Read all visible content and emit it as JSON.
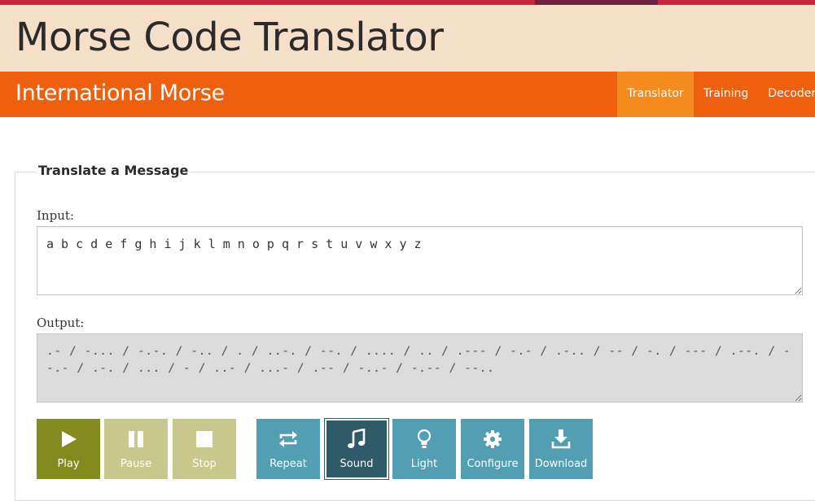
{
  "header": {
    "site_title": "Morse Code Translator",
    "subtitle": "International Morse"
  },
  "nav": {
    "items": [
      {
        "label": "Translator",
        "active": true
      },
      {
        "label": "Training",
        "active": false
      },
      {
        "label": "Decoder",
        "active": false
      }
    ]
  },
  "translate": {
    "legend": "Translate a Message",
    "input_label": "Input:",
    "input_value": "a b c d e f g h i j k l m n o p q r s t u v w x y z",
    "output_label": "Output:",
    "output_value": ".- / -... / -.-. / -.. / . / ..-. / --. / .... / .. / .--- / -.- / .-.. / -- / -. / --- / .--. / --.- / .-. / ... / - / ..- / ...- / .-- / -..- / -.-- / --.."
  },
  "controls": {
    "play": {
      "label": "Play",
      "icon": "play-icon"
    },
    "pause": {
      "label": "Pause",
      "icon": "pause-icon"
    },
    "stop": {
      "label": "Stop",
      "icon": "stop-icon"
    },
    "repeat": {
      "label": "Repeat",
      "icon": "repeat-icon"
    },
    "sound": {
      "label": "Sound",
      "icon": "music-note-icon",
      "active": true
    },
    "light": {
      "label": "Light",
      "icon": "lightbulb-icon"
    },
    "configure": {
      "label": "Configure",
      "icon": "gear-icon"
    },
    "download": {
      "label": "Download",
      "icon": "download-icon"
    }
  },
  "colors": {
    "top_stripe": "#c8253d",
    "title_band": "#f6dfc8",
    "nav_band": "#ef600e",
    "nav_active": "#f58a1f",
    "play_button": "#838a1e",
    "inactive_playback": "#c8c88c",
    "option_button": "#529fb4",
    "option_active": "#2e5a6a"
  }
}
